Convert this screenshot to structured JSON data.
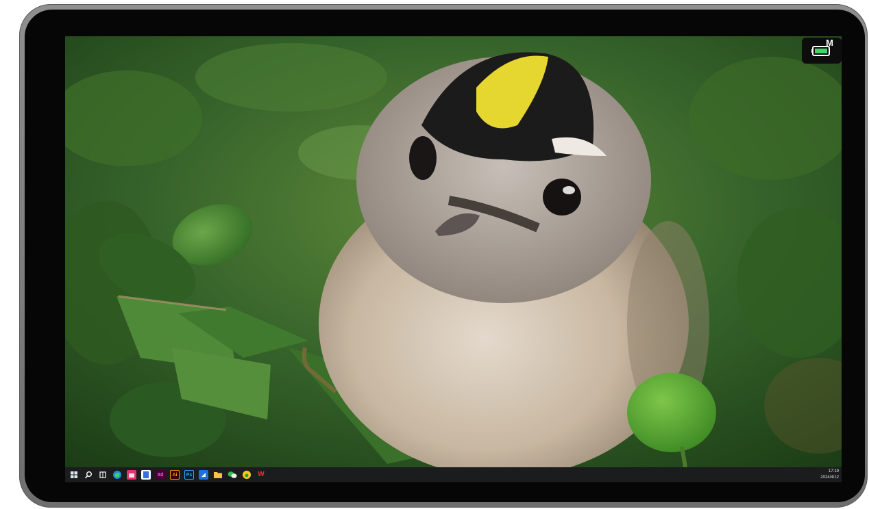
{
  "device": {
    "frame_color": "#7a7a7a",
    "bezel_color": "#060606"
  },
  "status_badge": {
    "label": "M",
    "icon": "battery-icon",
    "color": "#3fd46a"
  },
  "taskbar": {
    "items": [
      {
        "name": "start-button",
        "icon": "windows-logo-icon",
        "label": ""
      },
      {
        "name": "search-button",
        "icon": "search-icon",
        "label": ""
      },
      {
        "name": "task-view-button",
        "icon": "task-view-icon",
        "label": ""
      },
      {
        "name": "edge-app",
        "icon": "edge-icon",
        "label": ""
      },
      {
        "name": "store-app",
        "icon": "store-icon",
        "label": ""
      },
      {
        "name": "document-app",
        "icon": "document-icon",
        "label": ""
      },
      {
        "name": "adobe-xd-app",
        "icon": "adobe-xd-icon",
        "label": "Xd"
      },
      {
        "name": "adobe-illustrator-app",
        "icon": "adobe-illustrator-icon",
        "label": "Ai"
      },
      {
        "name": "adobe-photoshop-app",
        "icon": "adobe-photoshop-icon",
        "label": "Ps"
      },
      {
        "name": "blue-app",
        "icon": "app-icon",
        "label": ""
      },
      {
        "name": "file-explorer-app",
        "icon": "folder-icon",
        "label": ""
      },
      {
        "name": "wechat-app",
        "icon": "wechat-icon",
        "label": ""
      },
      {
        "name": "yellow-app",
        "icon": "app-icon",
        "label": ""
      },
      {
        "name": "wps-app",
        "icon": "wps-icon",
        "label": "W"
      }
    ],
    "clock": {
      "time": "17:19",
      "date": "2024/4/12"
    }
  }
}
